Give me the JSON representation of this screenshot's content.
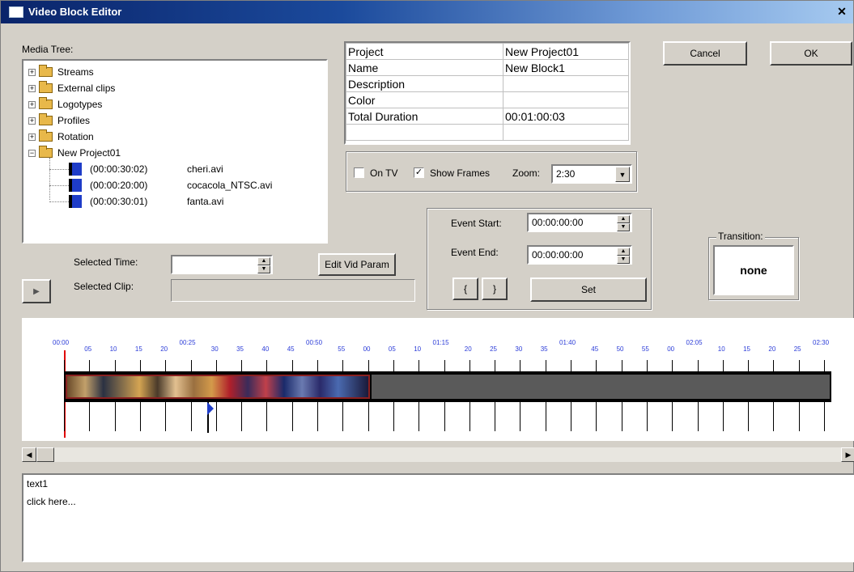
{
  "window": {
    "title": "Video Block Editor",
    "close_glyph": "✕"
  },
  "media_tree": {
    "label": "Media Tree:",
    "folders": [
      "Streams",
      "External clips",
      "Logotypes",
      "Profiles",
      "Rotation",
      "New Project01"
    ],
    "clips": [
      {
        "duration": "(00:00:30:02)",
        "name": "cheri.avi"
      },
      {
        "duration": "(00:00:20:00)",
        "name": "cocacola_NTSC.avi"
      },
      {
        "duration": "(00:00:30:01)",
        "name": "fanta.avi"
      }
    ]
  },
  "properties": {
    "rows": [
      {
        "key": "Project",
        "value": "New Project01"
      },
      {
        "key": "Name",
        "value": "New Block1"
      },
      {
        "key": "Description",
        "value": ""
      },
      {
        "key": "Color",
        "value": ""
      },
      {
        "key": "Total Duration",
        "value": "00:01:00:03"
      }
    ]
  },
  "buttons": {
    "cancel": "Cancel",
    "ok": "OK",
    "edit_vid_param": "Edit Vid Param",
    "set": "Set",
    "bracket_open": "{",
    "bracket_close": "}"
  },
  "display_options": {
    "on_tv_label": "On TV",
    "on_tv_checked": false,
    "show_frames_label": "Show Frames",
    "show_frames_checked": true,
    "zoom_label": "Zoom:",
    "zoom_value": "2:30"
  },
  "event": {
    "start_label": "Event Start:",
    "start_value": "00:00:00:00",
    "end_label": "Event End:",
    "end_value": "00:00:00:00"
  },
  "transition": {
    "label": "Transition:",
    "value": "none"
  },
  "selection": {
    "time_label": "Selected Time:",
    "time_value": "",
    "clip_label": "Selected Clip:",
    "clip_value": ""
  },
  "timeline": {
    "ticks": [
      "00:00",
      "05",
      "10",
      "15",
      "20",
      "00:25",
      "30",
      "35",
      "40",
      "45",
      "00:50",
      "55",
      "00",
      "05",
      "10",
      "01:15",
      "20",
      "25",
      "30",
      "35",
      "01:40",
      "45",
      "50",
      "55",
      "00",
      "02:05",
      "10",
      "15",
      "20",
      "25",
      "02:30"
    ]
  },
  "notes": {
    "title": "text1",
    "placeholder": "click here..."
  },
  "icons": {
    "play": "play-icon",
    "left_arrow": "scroll-left-icon",
    "right_arrow": "scroll-right-icon",
    "folder": "folder-icon",
    "clip": "film-clip-icon",
    "marker": "playhead-marker-icon"
  },
  "colors": {
    "tick_label": "#2b3cd8",
    "cursor": "#e00000",
    "clip_icon": "#1e3cc8"
  }
}
